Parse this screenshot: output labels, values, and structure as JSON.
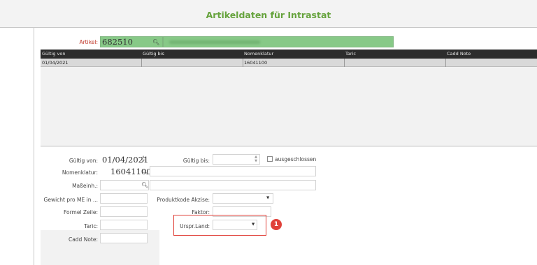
{
  "window": {
    "title": "Artikeldaten für Intrastat"
  },
  "article": {
    "label": "Artikel:",
    "number": "682510",
    "description_redacted": true
  },
  "grid": {
    "columns": [
      "Gültig von",
      "Gültig bis",
      "Nomenklatur",
      "Taric",
      "Cadd Note"
    ],
    "rows": [
      {
        "gueltig_von": "01/04/2021",
        "gueltig_bis": "",
        "nomenklatur": "16041100",
        "taric": "",
        "cadd_note": ""
      }
    ]
  },
  "form": {
    "gueltig_von_label": "Gültig von:",
    "gueltig_von_value": "01/04/2021",
    "gueltig_bis_label": "Gültig bis:",
    "gueltig_bis_value": "",
    "ausgeschlossen_label": "ausgeschlossen",
    "ausgeschlossen_checked": false,
    "nomenklatur_label": "Nomenklatur:",
    "nomenklatur_value": "16041100",
    "masseinh_label": "Maßeinh.:",
    "gewicht_label": "Gewicht pro ME in ...",
    "produktkode_label": "Produktkode Akzise:",
    "formel_label": "Formel Zeile:",
    "faktor_label": "Faktor:",
    "taric_label": "Taric:",
    "urspr_label": "Urspr.Land:",
    "cadd_label": "Cadd Note:"
  },
  "annotation": {
    "badge": "1",
    "color": "#e0413a"
  },
  "colors": {
    "title": "#66a33d",
    "article_field": "#87c987",
    "grid_header": "#2c2c2c"
  }
}
